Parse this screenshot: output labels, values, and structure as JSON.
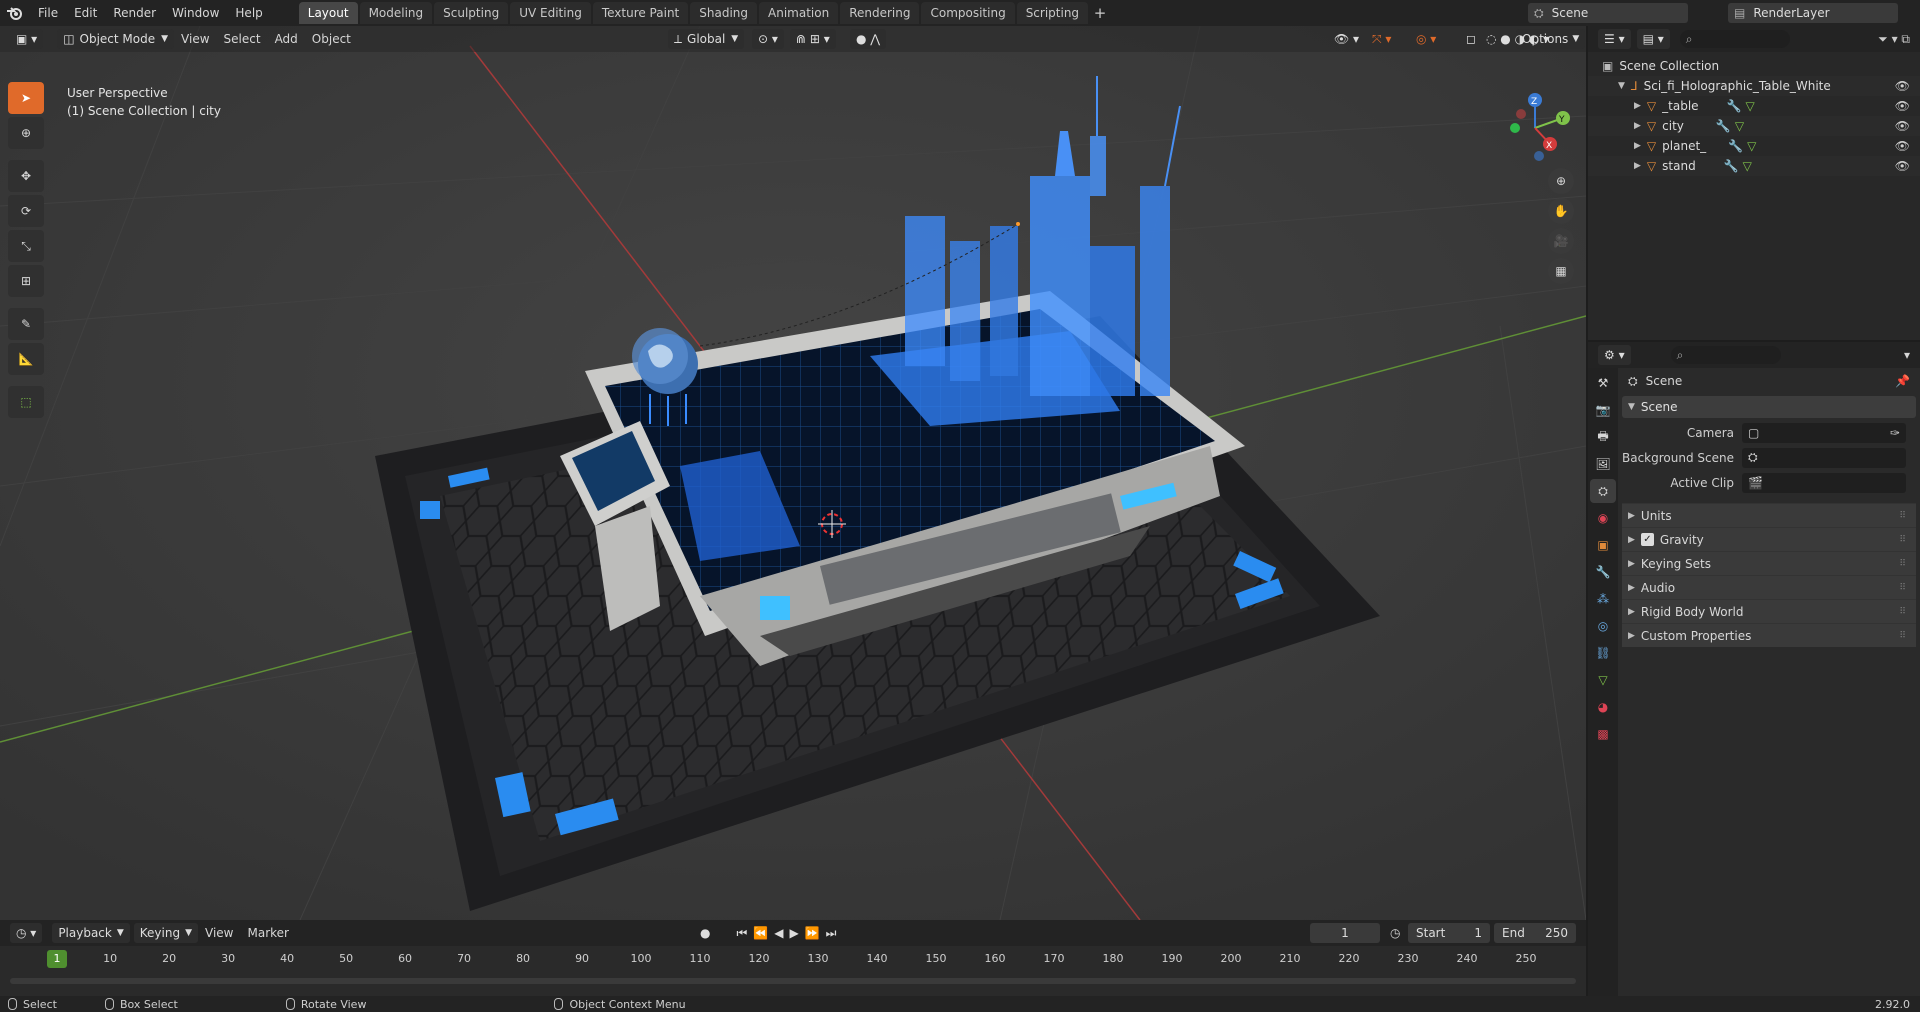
{
  "topbar": {
    "menus": [
      "File",
      "Edit",
      "Render",
      "Window",
      "Help"
    ],
    "workspaces": [
      "Layout",
      "Modeling",
      "Sculpting",
      "UV Editing",
      "Texture Paint",
      "Shading",
      "Animation",
      "Rendering",
      "Compositing",
      "Scripting"
    ],
    "active_workspace": "Layout",
    "add_tab": "+",
    "scene_name": "Scene",
    "view_layer": "RenderLayer"
  },
  "viewport": {
    "mode": "Object Mode",
    "menus": [
      "View",
      "Select",
      "Add",
      "Object"
    ],
    "orientation": "Global",
    "options": "Options",
    "overlay_title": "User Perspective",
    "overlay_subtitle": "(1) Scene Collection | city",
    "gizmo": {
      "z": "Z",
      "y": "Y",
      "x": "X"
    }
  },
  "timeline": {
    "menus": [
      "Playback",
      "Keying",
      "View",
      "Marker"
    ],
    "current_frame": "1",
    "start_label": "Start",
    "start_value": "1",
    "end_label": "End",
    "end_value": "250",
    "ticks": [
      "1",
      "10",
      "20",
      "30",
      "40",
      "50",
      "60",
      "70",
      "80",
      "90",
      "100",
      "110",
      "120",
      "130",
      "140",
      "150",
      "160",
      "170",
      "180",
      "190",
      "200",
      "210",
      "220",
      "230",
      "240",
      "250"
    ]
  },
  "statusbar": {
    "select": "Select",
    "box_select": "Box Select",
    "rotate_view": "Rotate View",
    "context_menu": "Object Context Menu",
    "version": "2.92.0"
  },
  "outliner": {
    "root": "Scene Collection",
    "collection": "Sci_fi_Holographic_Table_White",
    "objects": [
      "_table",
      "city",
      "planet_",
      "stand"
    ]
  },
  "properties": {
    "header": "Scene",
    "section": "Scene",
    "camera_label": "Camera",
    "bg_label": "Background Scene",
    "clip_label": "Active Clip",
    "subsections": [
      "Units",
      "Gravity",
      "Keying Sets",
      "Audio",
      "Rigid Body World",
      "Custom Properties"
    ],
    "gravity_checked": true
  },
  "colors": {
    "accent": "#e06a2a",
    "hologram": "#3a8cff",
    "x_axis": "#d43c3c",
    "y_axis": "#7fc24a",
    "z_axis": "#3a7bd5"
  }
}
